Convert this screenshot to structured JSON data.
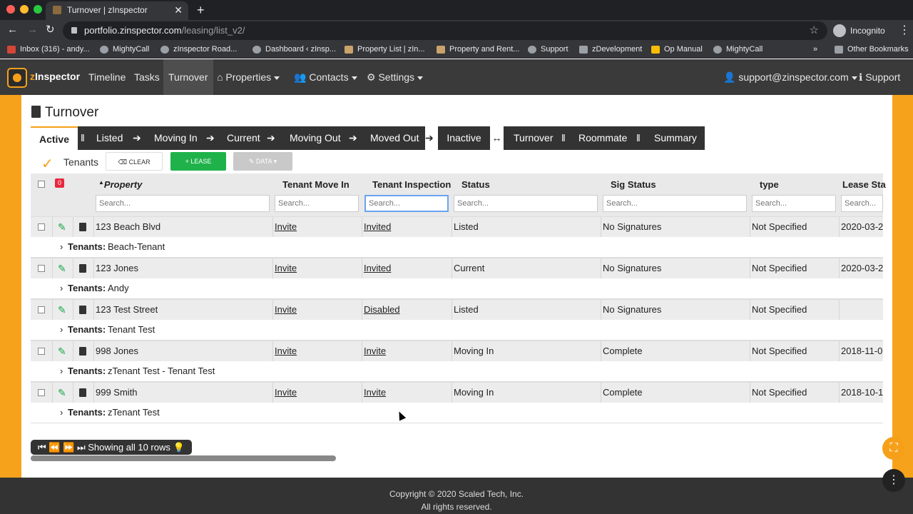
{
  "browser": {
    "tab_title": "Turnover | zInspector",
    "url_host": "portfolio.zinspector.com",
    "url_path": "/leasing/list_v2/",
    "profile": "Incognito",
    "bookmarks": [
      "Inbox (316) - andy...",
      "MightyCall",
      "zInspector Road...",
      "Dashboard ‹ zInsp...",
      "Property List | zIn...",
      "Property and Rent...",
      "Support",
      "zDevelopment",
      "Op Manual",
      "MightyCall"
    ],
    "other_bookmarks": "Other Bookmarks",
    "overflow": "»"
  },
  "app": {
    "brand_prefix": "z",
    "brand_rest": "Inspector",
    "nav": [
      "Timeline",
      "Tasks",
      "Turnover",
      "Properties",
      "Contacts",
      "Settings"
    ],
    "user": "support@zinspector.com",
    "support": "Support"
  },
  "page": {
    "title": "Turnover",
    "active_tab": "Active",
    "flow": [
      "Listed",
      "Moving In",
      "Current",
      "Moving Out",
      "Moved Out"
    ],
    "inactive": "Inactive",
    "right_tabs": [
      "Turnover",
      "Roommate",
      "Summary"
    ],
    "toolbar": {
      "tenants": "Tenants",
      "clear": "CLEAR",
      "lease": "LEASE",
      "data": "DATA"
    }
  },
  "table": {
    "badge": "0",
    "columns": [
      "Property",
      "Tenant Move In",
      "Tenant Inspection",
      "Status",
      "Sig Status",
      "type",
      "Lease Sta"
    ],
    "search_placeholder": "Search...",
    "rows": [
      {
        "property": "123 Beach Blvd",
        "move_in": "Invite",
        "inspection": "Invited",
        "status": "Listed",
        "sig": "No Signatures",
        "type": "Not Specified",
        "lease": "2020-03-2",
        "tenants": "Beach-Tenant"
      },
      {
        "property": "123 Jones",
        "move_in": "Invite",
        "inspection": "Invited",
        "status": "Current",
        "sig": "No Signatures",
        "type": "Not Specified",
        "lease": "2020-03-2",
        "tenants": "Andy"
      },
      {
        "property": "123 Test Street",
        "move_in": "Invite",
        "inspection": "Disabled",
        "status": "Listed",
        "sig": "No Signatures",
        "type": "Not Specified",
        "lease": "",
        "tenants": "Tenant Test"
      },
      {
        "property": "998 Jones",
        "move_in": "Invite",
        "inspection": "Invite",
        "status": "Moving In",
        "sig": "Complete",
        "type": "Not Specified",
        "lease": "2018-11-0",
        "tenants": "zTenant Test - Tenant Test"
      },
      {
        "property": "999 Smith",
        "move_in": "Invite",
        "inspection": "Invite",
        "status": "Moving In",
        "sig": "Complete",
        "type": "Not Specified",
        "lease": "2018-10-1",
        "tenants": "zTenant Test"
      }
    ],
    "tenants_label": "Tenants:",
    "pager_text": "Showing all 10 rows"
  },
  "footer": {
    "line1": "Copyright © 2020 Scaled Tech, Inc.",
    "line2": "All rights reserved."
  }
}
